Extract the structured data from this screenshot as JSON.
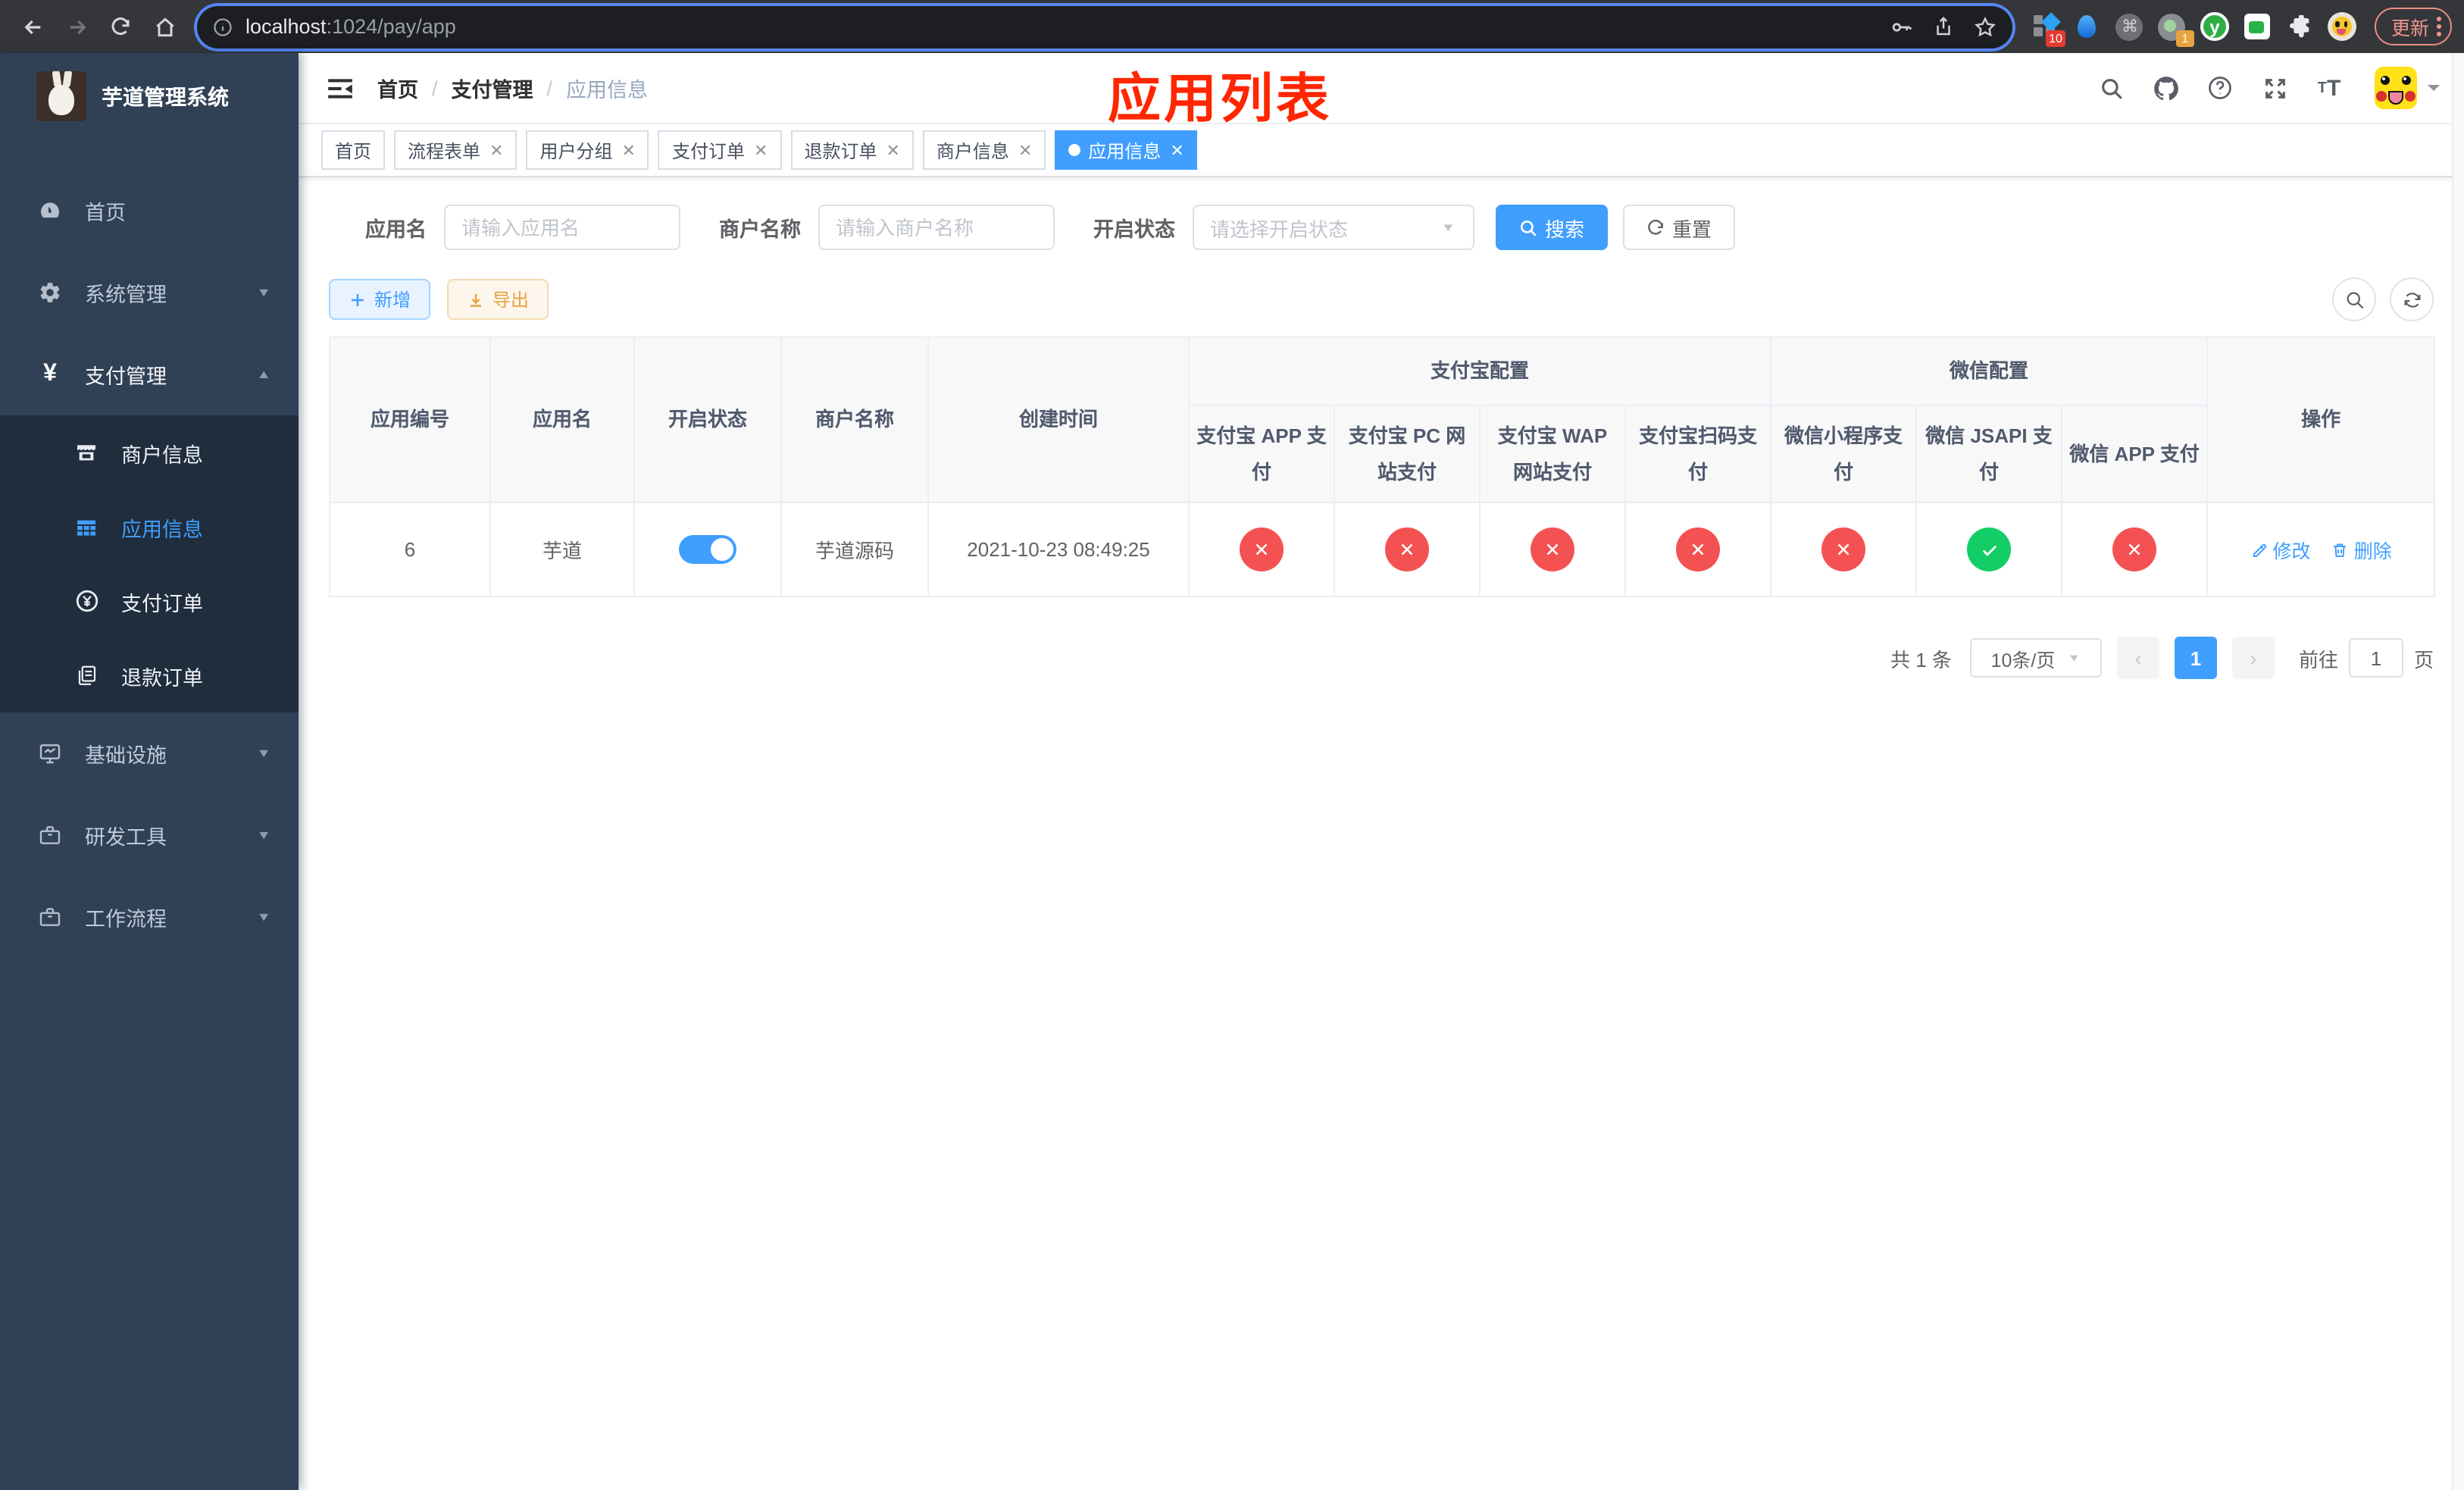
{
  "colors": {
    "accent": "#409eff",
    "danger": "#f45252",
    "success": "#13ce66",
    "sidebar_bg": "#304156",
    "submenu_bg": "#1f2d3d",
    "annotation_red": "#ff2600"
  },
  "browser": {
    "url_host": "localhost",
    "url_rest": ":1024/pay/app",
    "update_label": "更新",
    "ext_badge_10": "10",
    "ext_badge_1": "1",
    "ext_y_label": "y"
  },
  "sidebar": {
    "title": "芋道管理系统",
    "home": "首页",
    "system": "系统管理",
    "payment": "支付管理",
    "sub_merchant": "商户信息",
    "sub_app": "应用信息",
    "sub_pay_order": "支付订单",
    "sub_refund_order": "退款订单",
    "infra": "基础设施",
    "devtools": "研发工具",
    "workflow": "工作流程"
  },
  "header": {
    "breadcrumb": {
      "0": "首页",
      "1": "支付管理",
      "2": "应用信息"
    },
    "annotation": "应用列表"
  },
  "tabs": [
    {
      "label": "首页"
    },
    {
      "label": "流程表单"
    },
    {
      "label": "用户分组"
    },
    {
      "label": "支付订单"
    },
    {
      "label": "退款订单"
    },
    {
      "label": "商户信息"
    },
    {
      "label": "应用信息"
    }
  ],
  "filters": {
    "app_name_label": "应用名",
    "app_name_placeholder": "请输入应用名",
    "merchant_label": "商户名称",
    "merchant_placeholder": "请输入商户名称",
    "status_label": "开启状态",
    "status_placeholder": "请选择开启状态",
    "search_label": "搜索",
    "reset_label": "重置"
  },
  "toolbar": {
    "add_label": "新增",
    "export_label": "导出"
  },
  "table": {
    "columns": {
      "0": "应用编号",
      "1": "应用名",
      "2": "开启状态",
      "3": "商户名称",
      "4": "创建时间"
    },
    "group_alipay": "支付宝配置",
    "group_wechat": "微信配置",
    "pay_columns": {
      "0": "支付宝 APP 支付",
      "1": "支付宝 PC 网站支付",
      "2": "支付宝 WAP 网站支付",
      "3": "支付宝扫码支付",
      "4": "微信小程序支付",
      "5": "微信 JSAPI 支付",
      "6": "微信 APP 支付"
    },
    "ops_column": "操作",
    "row": {
      "id": "6",
      "name": "芋道",
      "merchant": "芋道源码",
      "created": "2021-10-23 08:49:25",
      "statuses": [
        "no",
        "no",
        "no",
        "no",
        "no",
        "yes",
        "no"
      ],
      "op_edit": "修改",
      "op_delete": "删除"
    }
  },
  "pagination": {
    "total": "共 1 条",
    "page_size": "10条/页",
    "page": "1",
    "goto_label": "前往",
    "goto_value": "1",
    "page_unit": "页"
  }
}
